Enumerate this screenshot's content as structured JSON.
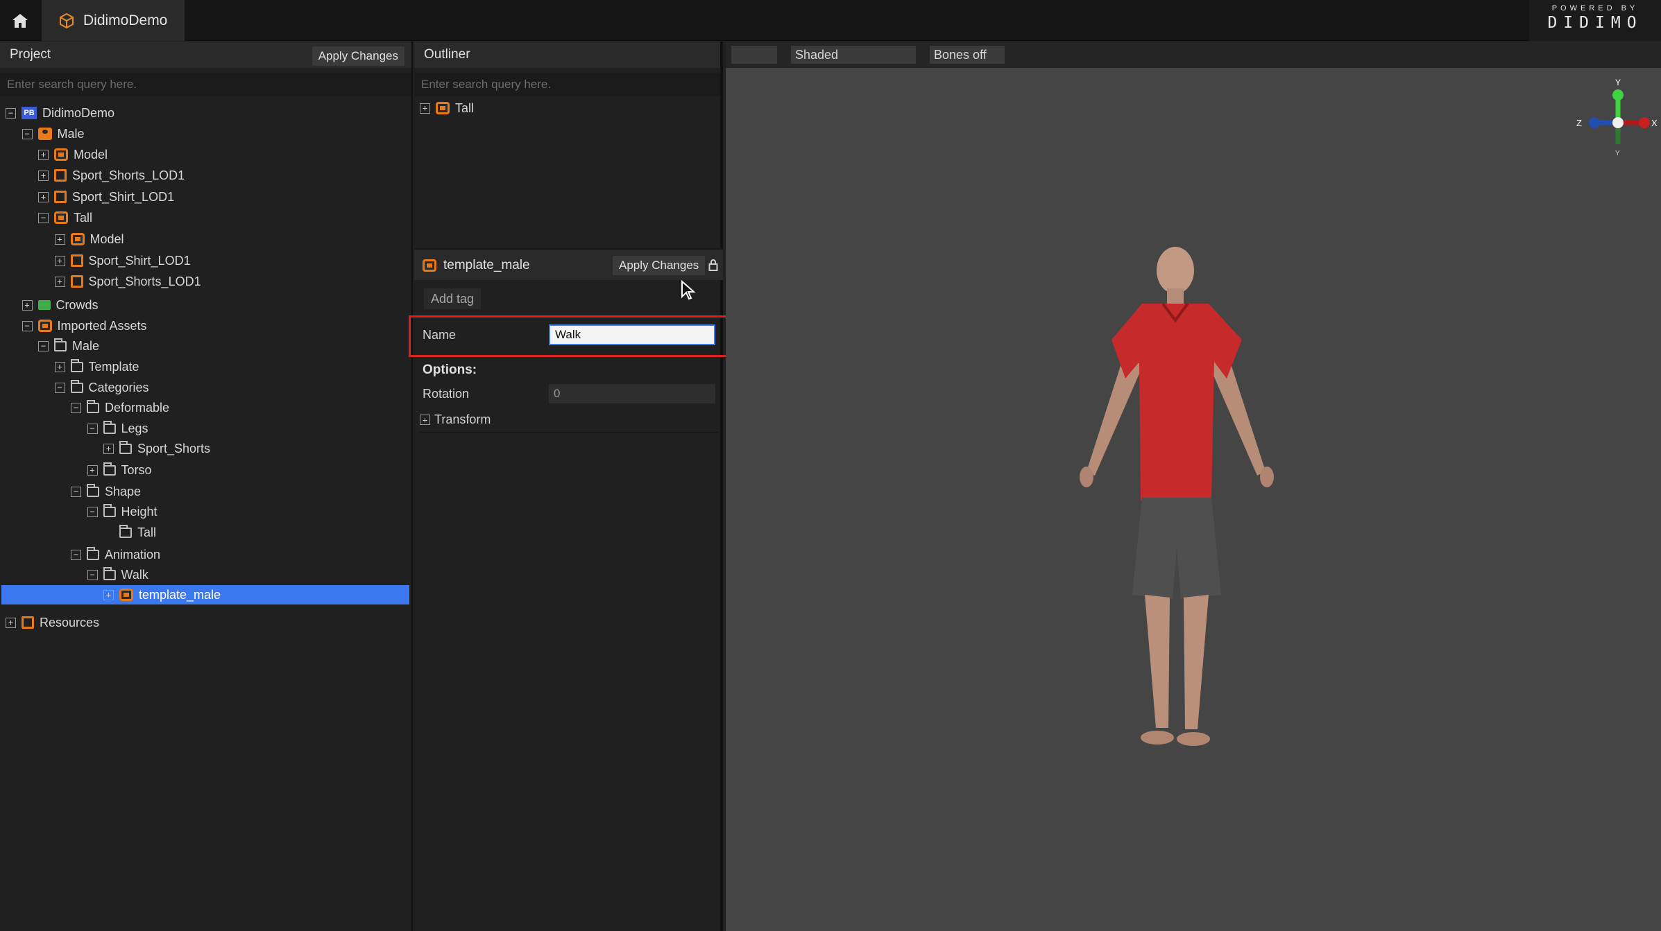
{
  "app": {
    "tab_title": "DidimoDemo",
    "logo_small": "POWERED BY",
    "logo_big": "DIDIMO"
  },
  "project": {
    "title": "Project",
    "apply_label": "Apply Changes",
    "search_placeholder": "Enter search query here.",
    "tree": [
      {
        "label": "DidimoDemo",
        "depth": 0,
        "toggle": "−",
        "icon": "blue"
      },
      {
        "label": "Male",
        "depth": 1,
        "toggle": "−",
        "icon": "person"
      },
      {
        "label": "Model",
        "depth": 2,
        "toggle": "+",
        "icon": "orange"
      },
      {
        "label": "Sport_Shorts_LOD1",
        "depth": 2,
        "toggle": "+",
        "icon": "orange-sq"
      },
      {
        "label": "Sport_Shirt_LOD1",
        "depth": 2,
        "toggle": "+",
        "icon": "orange-sq"
      },
      {
        "label": "Tall",
        "depth": 2,
        "toggle": "−",
        "icon": "orange"
      },
      {
        "label": "Model",
        "depth": 3,
        "toggle": "+",
        "icon": "orange"
      },
      {
        "label": "Sport_Shirt_LOD1",
        "depth": 3,
        "toggle": "+",
        "icon": "orange-sq"
      },
      {
        "label": "Sport_Shorts_LOD1",
        "depth": 3,
        "toggle": "+",
        "icon": "orange-sq"
      },
      {
        "label": "Crowds",
        "depth": 1,
        "toggle": "+",
        "icon": "green"
      },
      {
        "label": "Imported Assets",
        "depth": 1,
        "toggle": "−",
        "icon": "orange"
      },
      {
        "label": "Male",
        "depth": 2,
        "toggle": "−",
        "icon": "folder"
      },
      {
        "label": "Template",
        "depth": 3,
        "toggle": "+",
        "icon": "folder"
      },
      {
        "label": "Categories",
        "depth": 3,
        "toggle": "−",
        "icon": "folder"
      },
      {
        "label": "Deformable",
        "depth": 4,
        "toggle": "−",
        "icon": "folder"
      },
      {
        "label": "Legs",
        "depth": 5,
        "toggle": "−",
        "icon": "folder"
      },
      {
        "label": "Sport_Shorts",
        "depth": 6,
        "toggle": "+",
        "icon": "folder"
      },
      {
        "label": "Torso",
        "depth": 5,
        "toggle": "+",
        "icon": "folder"
      },
      {
        "label": "Shape",
        "depth": 4,
        "toggle": "−",
        "icon": "folder"
      },
      {
        "label": "Height",
        "depth": 5,
        "toggle": "−",
        "icon": "folder"
      },
      {
        "label": "Tall",
        "depth": 6,
        "toggle": "",
        "icon": "folder"
      },
      {
        "label": "Animation",
        "depth": 4,
        "toggle": "−",
        "icon": "folder"
      },
      {
        "label": "Walk",
        "depth": 5,
        "toggle": "−",
        "icon": "folder"
      },
      {
        "label": "template_male",
        "depth": 6,
        "toggle": "+",
        "icon": "orange",
        "selected": true
      },
      {
        "label": "Resources",
        "depth": 0,
        "toggle": "+",
        "icon": "orange-sq"
      }
    ]
  },
  "outliner": {
    "title": "Outliner",
    "search_placeholder": "Enter search query here.",
    "items": [
      {
        "label": "Tall"
      }
    ]
  },
  "properties": {
    "object_name": "template_male",
    "apply_label": "Apply Changes",
    "add_tag_label": "Add tag",
    "name_label": "Name",
    "name_value": "Walk",
    "options_label": "Options:",
    "rotation_label": "Rotation",
    "rotation_value": "0",
    "transform_label": "Transform"
  },
  "viewport": {
    "shading_mode": "Shaded",
    "bones_mode": "Bones off",
    "gizmo": {
      "axis_y": "Y",
      "axis_x": "X",
      "axis_z": "Z",
      "axis_neg_y": "Y"
    }
  }
}
